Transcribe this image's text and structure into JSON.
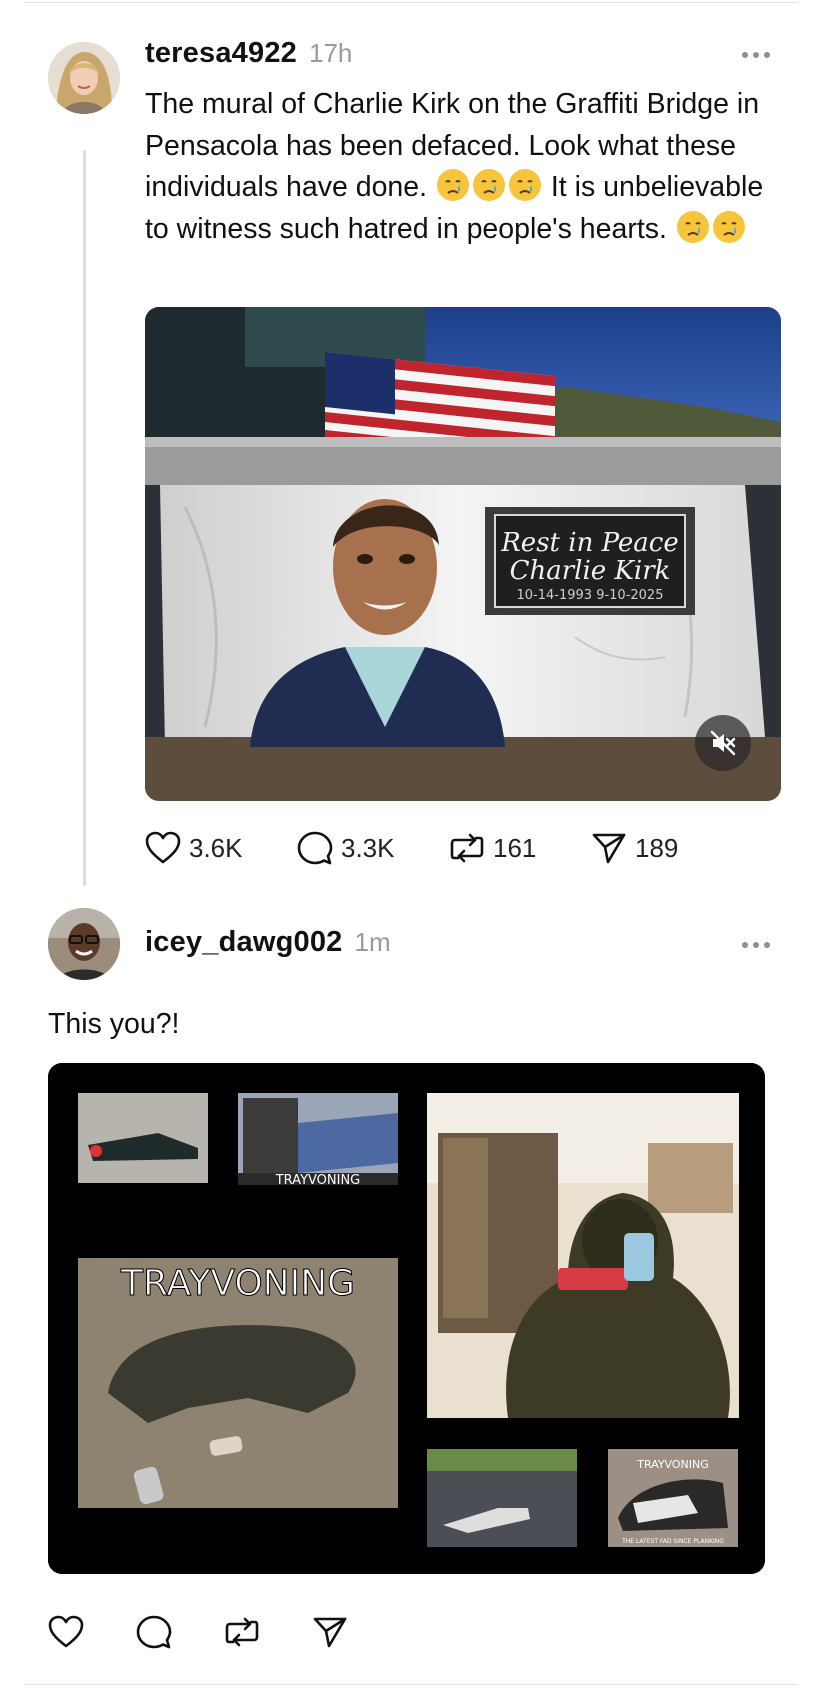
{
  "post1": {
    "username": "teresa4922",
    "timestamp": "17h",
    "text_part1": "The mural of Charlie Kirk on the Graffiti Bridge in Pensacola has been defaced. Look what these individuals have done.",
    "text_part2": "It is unbelievable to witness such hatred in people's hearts.",
    "media": {
      "mural_line1": "Rest in Peace",
      "mural_line2": "Charlie Kirk",
      "mural_dates": "10-14-1993  9-10-2025"
    },
    "actions": {
      "likes": "3.6K",
      "replies": "3.3K",
      "reposts": "161",
      "shares": "189"
    }
  },
  "post2": {
    "username": "icey_dawg002",
    "timestamp": "1m",
    "text": "This you?!",
    "media": {
      "caption_small": "TRAYVONING",
      "caption_large": "TRAYVONING",
      "caption_corner_top": "TRAYVONING",
      "caption_corner_bottom": "THE LATEST FAD SINCE PLANKING"
    }
  },
  "icons": {
    "like": "heart-icon",
    "reply": "comment-icon",
    "repost": "repost-icon",
    "share": "send-icon",
    "more": "more-dots-icon",
    "mute": "speaker-muted-icon"
  },
  "colors": {
    "text": "#111111",
    "muted": "#9a9a9a",
    "divider": "#dcdcdc"
  }
}
